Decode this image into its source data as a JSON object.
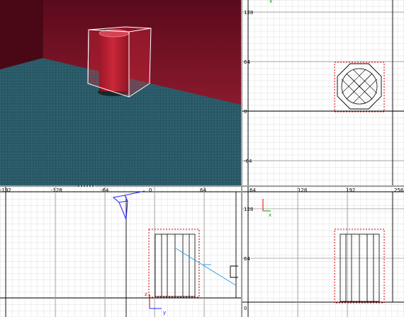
{
  "viewports": {
    "top": {
      "labels": {
        "v128": "128",
        "v64": "64",
        "v0": "0",
        "vn64": "-64"
      }
    },
    "side": {
      "labels": {
        "hn192": "-192",
        "hn128": "-128",
        "hn64": "-64",
        "h0": "0",
        "h64": "64"
      },
      "axes": {
        "z": "z",
        "y": "y"
      }
    },
    "front": {
      "labels": {
        "h64": "64",
        "h128": "128",
        "h192": "192",
        "h256": "256",
        "v128": "128",
        "v64": "64",
        "v0": "0"
      },
      "axes": {
        "x": "x"
      }
    }
  },
  "colors": {
    "grid": "#d4d4d4",
    "grid_major": "#9a9a9a",
    "selection": "#e00000",
    "brush": "#000000",
    "camera": "#2020ff",
    "floor": "#2a5866",
    "wall": "#6b0f1f"
  }
}
